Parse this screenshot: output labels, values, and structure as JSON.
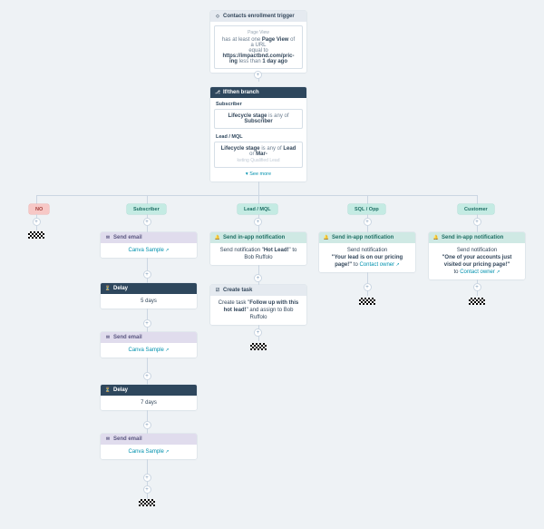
{
  "trigger": {
    "head": "Contacts enrollment trigger",
    "tiny": "Page View",
    "line_a": "has at least one ",
    "line_b": "Page View",
    "line_c": " of a URL",
    "line_d": "equal to ",
    "line_e": "https://impactbnd.com/pric-",
    "line_f": "ing",
    "line_g": " less than ",
    "line_h": "1 day ago"
  },
  "branch": {
    "head": "If/then branch",
    "g1_label": "Subscriber",
    "g1_rule_a": "Lifecycle stage",
    "g1_rule_b": " is any of ",
    "g1_rule_c": "Subscriber",
    "g2_label": "Lead / MQL",
    "g2_rule_a": "Lifecycle stage",
    "g2_rule_b": " is any of ",
    "g2_rule_c": "Lead",
    "g2_rule_d": " or ",
    "g2_rule_e": "Mar-",
    "g2_rule_f": "keting Qualified Lead",
    "see_more": "See more"
  },
  "labels": {
    "no": "NO",
    "sub": "Subscriber",
    "lead": "Lead / MQL",
    "sql": "SQL / Opp",
    "cust": "Customer"
  },
  "mail_head": "Send email",
  "delay_head": "Delay",
  "notif_head": "Send in-app notification",
  "task_head": "Create task",
  "canva": "Canva Sample",
  "delay1": "5 days",
  "delay2": "7 days",
  "n_lead_a": "Send notification \"",
  "n_lead_b": "Hot Lead!",
  "n_lead_c": "\" to Bob Ruffolo",
  "task_a": "Create task \"",
  "task_b": "Follow up with this hot lead!",
  "task_c": "\" and assign to Bob Ruffolo",
  "n_sql_a": "Send notification",
  "n_sql_b": "\"Your lead is on our pricing page!\"",
  "n_sql_c": " to ",
  "n_sql_d": "Contact owner",
  "n_cust_a": "Send notification",
  "n_cust_b": "\"One of your accounts just visited our pricing page!\"",
  "n_cust_c": "to ",
  "n_cust_d": "Contact owner"
}
